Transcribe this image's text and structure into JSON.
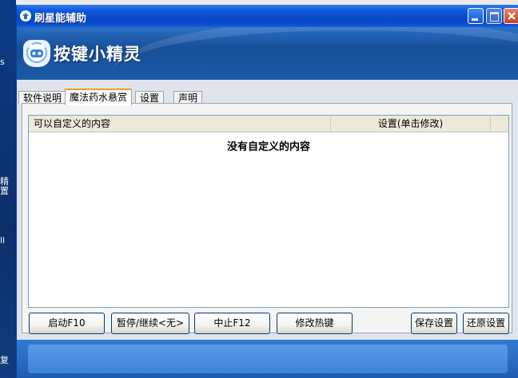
{
  "desktop": {
    "side_chars": [
      "s",
      "精",
      "置",
      "ll",
      "复"
    ]
  },
  "window": {
    "title": "刷星能辅助",
    "banner_title": "按键小精灵"
  },
  "tabs": [
    {
      "label": "软件说明",
      "active": false
    },
    {
      "label": "魔法药水悬赏",
      "active": true
    },
    {
      "label": "设置",
      "active": false
    },
    {
      "label": "声明",
      "active": false
    }
  ],
  "list": {
    "columns": [
      "可以自定义的内容",
      "设置(单击修改)"
    ],
    "empty_message": "没有自定义的内容"
  },
  "buttons": {
    "start": "启动F10",
    "pause": "暂停/继续<无>",
    "stop": "中止F12",
    "hotkey": "修改热键",
    "save": "保存设置",
    "restore": "还原设置"
  },
  "colors": {
    "title_bar": "#0a4bcc",
    "banner": "#1b5aa6",
    "active_tab_accent": "#f0a020"
  }
}
